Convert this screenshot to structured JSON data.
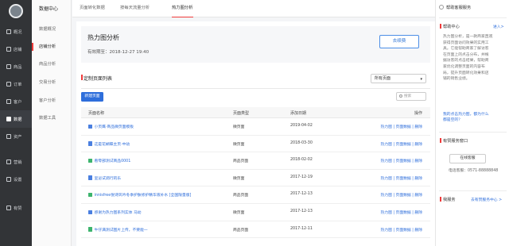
{
  "sidebar": {
    "items": [
      {
        "label": "概况",
        "icon": "overview-icon"
      },
      {
        "label": "店铺",
        "icon": "store-icon"
      },
      {
        "label": "商品",
        "icon": "goods-icon"
      },
      {
        "label": "订单",
        "icon": "order-icon"
      },
      {
        "label": "客户",
        "icon": "customer-icon"
      },
      {
        "label": "数据",
        "icon": "data-icon"
      },
      {
        "label": "资产",
        "icon": "asset-icon"
      },
      {
        "label": "营销",
        "icon": "marketing-icon"
      },
      {
        "label": "设置",
        "icon": "settings-icon"
      },
      {
        "label": "有赞",
        "icon": "youzan-icon"
      }
    ]
  },
  "subnav": {
    "title": "数据中心",
    "items": [
      "数据概况",
      "店铺分析",
      "商品分析",
      "交易分析",
      "客户分析",
      "数据工具"
    ]
  },
  "tabs": [
    "页面转化数据",
    "按每天流量分析",
    "热力图分析"
  ],
  "hero": {
    "title": "热力图分析",
    "expiry": "有效期至：2018-12-27 19:40",
    "renew_label": "去续费"
  },
  "list": {
    "title": "定制页面列表",
    "filter_value": "所有页面",
    "new_button": "新建页面",
    "search_placeholder": "搜索"
  },
  "table": {
    "columns": [
      "页面名称",
      "页面类型",
      "添加日期",
      "操作"
    ],
    "rows": [
      {
        "name": "小页鹰·商品微页面模板",
        "type": "微页面",
        "date": "2019-04-02",
        "ops": "热力图 | 页面数据 | 删除",
        "doc_color": "#4a7fe0"
      },
      {
        "name": "这是花蝴蝶主页·中幼",
        "type": "微页面",
        "date": "2018-03-30",
        "ops": "热力图 | 页面数据 | 删除",
        "doc_color": "#4a7fe0"
      },
      {
        "name": "看零部测试商品0001",
        "type": "商品页面",
        "date": "2018-02-02",
        "ops": "热力图 | 页面数据 | 删除",
        "doc_color": "#3db46d"
      },
      {
        "name": "呈泌试调行的乐",
        "type": "微页面",
        "date": "2017-12-19",
        "ops": "热力图 | 页面数据 | 删除",
        "doc_color": "#4a7fe0"
      },
      {
        "name": "innisfree悦诗风吟冬季护肤修护精华液补水 [全国限量版]",
        "type": "商品页面",
        "date": "2017-12-13",
        "ops": "热力图 | 页面数据 | 删除",
        "doc_color": "#3db46d"
      },
      {
        "name": "感谢为热力图系列实体 马幼",
        "type": "微页面",
        "date": "2017-12-13",
        "ops": "热力图 | 页面数据 | 删除",
        "doc_color": "#4a7fe0"
      },
      {
        "name": "牛仔满测试图片上传，不要能—",
        "type": "商品页面",
        "date": "2017-12-11",
        "ops": "热力图 | 页面数据 | 删除",
        "doc_color": "#3db46d"
      }
    ]
  },
  "rpanel": {
    "title": "帮助客服服务",
    "help_head": "帮助中心",
    "help_link": "进入>",
    "help_body": [
      "热力图分析，是一款商家直观",
      "获得页面访问效果的实用工",
      "具。它能帮助商家了解访客",
      "在页面上的点击分布，并根",
      "据访客的点击结果，帮助商",
      "家优化调整页面的内容布",
      "局，提升页面转化效果和店",
      "铺的销售业绩。"
    ],
    "question": [
      "我的点击热力图，都为什么",
      "都是空的？"
    ],
    "service_head": "有赞服务窗口",
    "cs_button": "在线客服",
    "phone": "电话客服：0571-88888848",
    "bottom_left": "我服务",
    "bottom_link": "去有赞服务中心 >"
  }
}
